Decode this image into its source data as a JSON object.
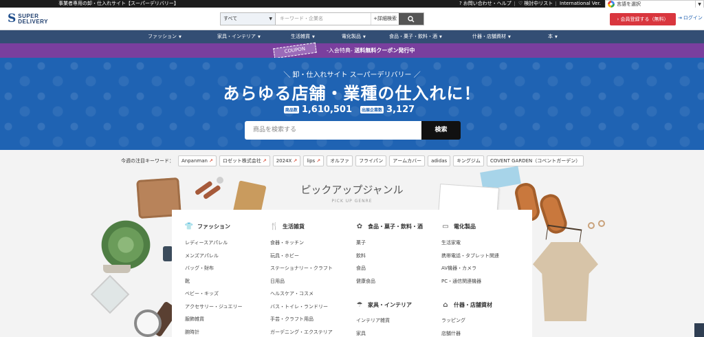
{
  "topbar": {
    "tagline": "事業者専用の卸・仕入れサイト【スーパーデリバリー】",
    "help": "お問い合わせ・ヘルプ",
    "wishlist": "検討中リスト",
    "intl": "International Ver.",
    "translate": "言語を選択"
  },
  "header": {
    "logo_line1": "SUPER",
    "logo_line2": "DELIVERY",
    "search_category": "すべて",
    "search_placeholder": "キーワード・企業名",
    "advanced": "+詳細検索",
    "register": "会員登録する（無料）",
    "login": "ログイン"
  },
  "nav": {
    "items": [
      "ファッション",
      "家具・インテリア",
      "生活雑貨",
      "電化製品",
      "食品・菓子・飲料・酒",
      "什器・店舗資材",
      "本"
    ]
  },
  "coupon": {
    "tag": "COUPON",
    "prefix": "-入会特典-",
    "text": "送料無料クーポン発行中"
  },
  "hero": {
    "subtitle": "＼ 卸・仕入れサイト スーパーデリバリー ／",
    "title": "あらゆる店舗・業種の仕入れに！",
    "stat1_label": "商品数",
    "stat1_value": "1,610,501",
    "stat2_label": "出展企業数",
    "stat2_value": "3,127",
    "search_placeholder": "商品を検索する",
    "search_button": "検索"
  },
  "keywords": {
    "label": "今週の注目キーワード：",
    "items": [
      {
        "text": "Anpanman",
        "hot": true
      },
      {
        "text": "ロゼット株式会社",
        "hot": true
      },
      {
        "text": "2024X",
        "hot": true
      },
      {
        "text": "lips",
        "hot": true
      },
      {
        "text": "オルファ",
        "hot": false
      },
      {
        "text": "フライパン",
        "hot": false
      },
      {
        "text": "アームカバー",
        "hot": false
      },
      {
        "text": "adidas",
        "hot": false
      },
      {
        "text": "キングジム",
        "hot": false
      },
      {
        "text": "COVENT GARDEN（コベントガーデン）",
        "hot": false
      }
    ]
  },
  "pickup": {
    "title": "ピックアップジャンル",
    "subtitle": "PICK UP GENRE",
    "fashion": {
      "title": "ファッション",
      "links": [
        "レディースアパレル",
        "メンズアパレル",
        "バッグ・財布",
        "靴",
        "ベビー・キッズ",
        "アクセサリー・ジュエリー",
        "服飾雑貨",
        "腕時計"
      ]
    },
    "living": {
      "title": "生活雑貨",
      "links": [
        "食器・キッチン",
        "玩具・ホビー",
        "ステーショナリー・クラフト",
        "日用品",
        "ヘルスケア・コスメ",
        "バス・トイレ・ランドリー",
        "手芸・クラフト用品",
        "ガーデニング・エクステリア"
      ]
    },
    "food": {
      "title": "食品・菓子・飲料・酒",
      "links": [
        "菓子",
        "飲料",
        "食品",
        "健康食品"
      ]
    },
    "furniture": {
      "title": "家具・インテリア",
      "links": [
        "インテリア雑貨",
        "家具"
      ]
    },
    "electronics": {
      "title": "電化製品",
      "links": [
        "生活家電",
        "携帯電話・タブレット関連",
        "AV機器・カメラ",
        "PC・通信関連機器"
      ]
    },
    "fixtures": {
      "title": "什器・店舗資材",
      "links": [
        "ラッピング",
        "店舗什器"
      ]
    }
  },
  "colors": {
    "nav": "#334e74",
    "coupon": "#7a3f9e",
    "hero": "#1f63b3",
    "register": "#d9363e"
  }
}
